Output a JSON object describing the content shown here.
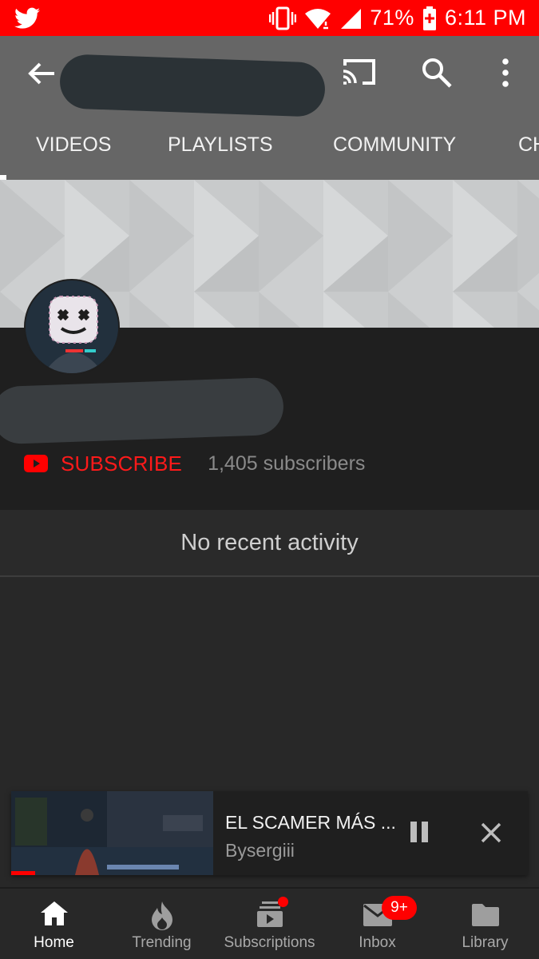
{
  "status_bar": {
    "battery": "71%",
    "time": "6:11 PM",
    "notification_icon": "twitter-icon"
  },
  "header": {
    "tabs": [
      "VIDEOS",
      "PLAYLISTS",
      "COMMUNITY",
      "CH"
    ]
  },
  "channel": {
    "subscribe_label": "SUBSCRIBE",
    "subscribers": "1,405 subscribers",
    "activity_text": "No recent activity"
  },
  "mini_player": {
    "title": "EL SCAMER MÁS ...",
    "channel": "Bysergiii"
  },
  "bottom_nav": {
    "items": [
      {
        "label": "Home",
        "icon": "home-icon"
      },
      {
        "label": "Trending",
        "icon": "flame-icon"
      },
      {
        "label": "Subscriptions",
        "icon": "subscriptions-icon"
      },
      {
        "label": "Inbox",
        "icon": "mail-icon"
      },
      {
        "label": "Library",
        "icon": "folder-icon"
      }
    ],
    "inbox_badge": "9+"
  },
  "colors": {
    "accent": "#ff0000",
    "app_bar": "#666666",
    "background": "#282828"
  }
}
